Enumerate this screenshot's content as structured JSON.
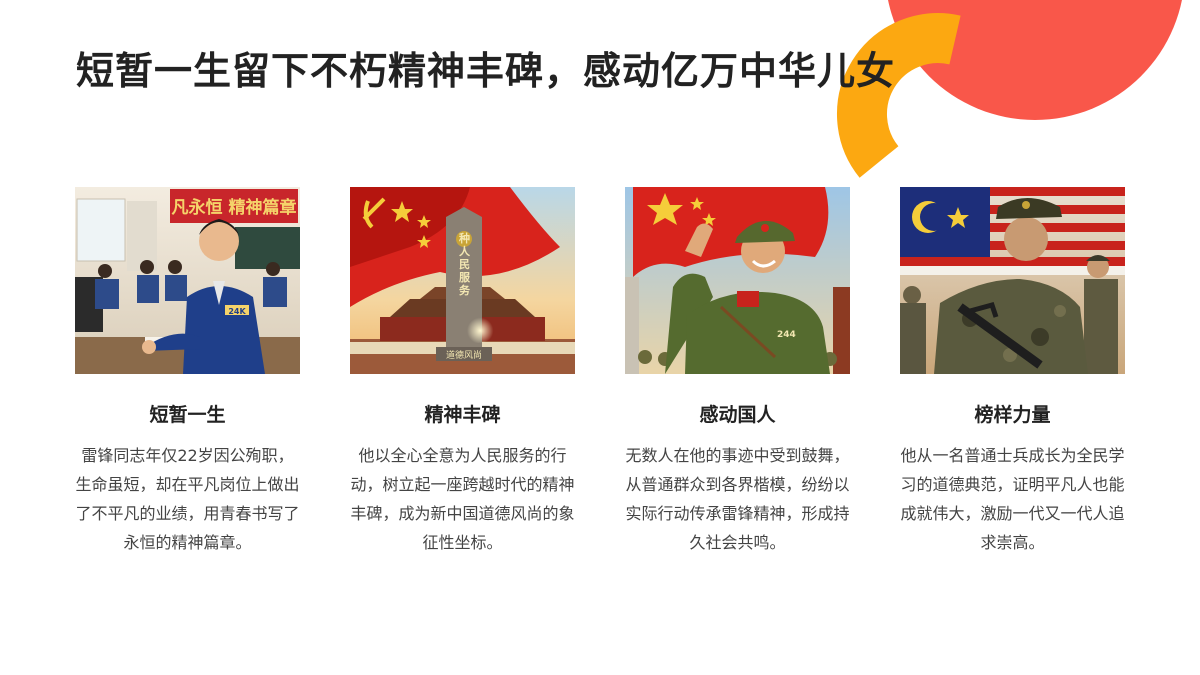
{
  "slide": {
    "title": "短暂一生留下不朽精神丰碑，感动亿万中华儿女"
  },
  "colors": {
    "accent_red": "#F9574A",
    "accent_orange": "#FCA811",
    "title": "#222222",
    "body": "#444444"
  },
  "cards": [
    {
      "title": "短暂一生",
      "desc": "雷锋同志年仅22岁因公殉职，生命虽短，却在平凡岗位上做出了不平凡的业绩，用青春书写了永恒的精神篇章。",
      "banner_text": "凡永恒 精神篇章",
      "badge_text": "24K"
    },
    {
      "title": "精神丰碑",
      "desc": "他以全心全意为人民服务的行动，树立起一座跨越时代的精神丰碑，成为新中国道德风尚的象征性坐标。",
      "monument_text": "种人民服务",
      "plaque_text": "道德风尚"
    },
    {
      "title": "感动国人",
      "desc": "无数人在他的事迹中受到鼓舞，从普通群众到各界楷模，纷纷以实际行动传承雷锋精神，形成持久社会共鸣。",
      "badge_text": "244"
    },
    {
      "title": "榜样力量",
      "desc": "他从一名普通士兵成长为全民学习的道德典范，证明平凡人也能成就伟大，激励一代又一代人追求崇高。"
    }
  ]
}
